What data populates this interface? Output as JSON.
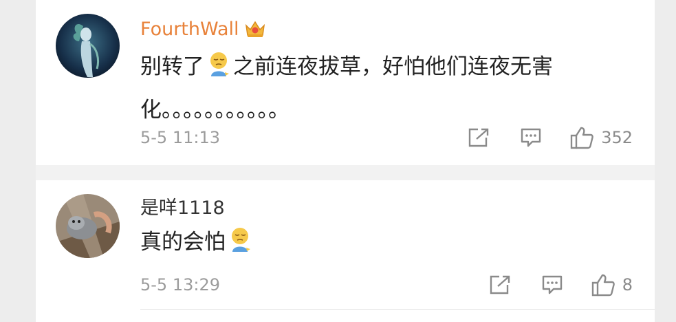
{
  "comments": [
    {
      "username": "FourthWall",
      "badge_icon": "crown-badge-icon",
      "text_before": "别转了",
      "emoji": "pensive-face-emoji",
      "text_after": "之前连夜拔草，好怕他们连夜无害化。。。。。。。。。。。",
      "time": "5-5 11:13",
      "like_count": "352",
      "name_color": "#e8823a"
    },
    {
      "username": "是咩1118",
      "text_before": "真的会怕",
      "emoji": "pensive-face-emoji",
      "text_after": "",
      "time": "5-5 13:29",
      "like_count": "8",
      "name_color": "#333333"
    }
  ],
  "icons": {
    "share": "share-icon",
    "reply": "comment-icon",
    "like": "thumbs-up-icon"
  }
}
